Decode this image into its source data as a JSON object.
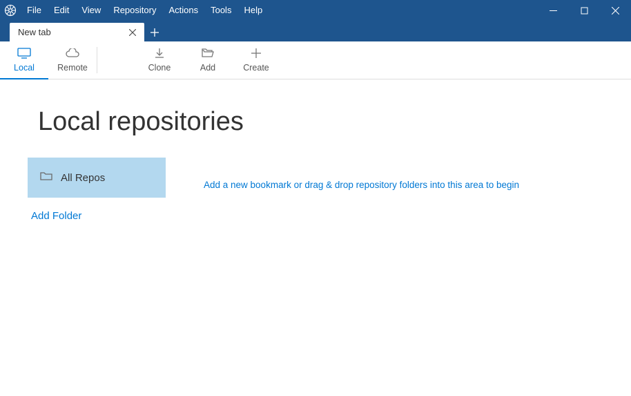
{
  "menubar": {
    "items": [
      "File",
      "Edit",
      "View",
      "Repository",
      "Actions",
      "Tools",
      "Help"
    ]
  },
  "tab": {
    "label": "New tab"
  },
  "toolbar": {
    "local": "Local",
    "remote": "Remote",
    "clone": "Clone",
    "add": "Add",
    "create": "Create"
  },
  "main": {
    "title": "Local repositories",
    "all_repos": "All Repos",
    "add_folder": "Add Folder",
    "hint": "Add a new bookmark or drag & drop repository folders into this area to begin"
  }
}
